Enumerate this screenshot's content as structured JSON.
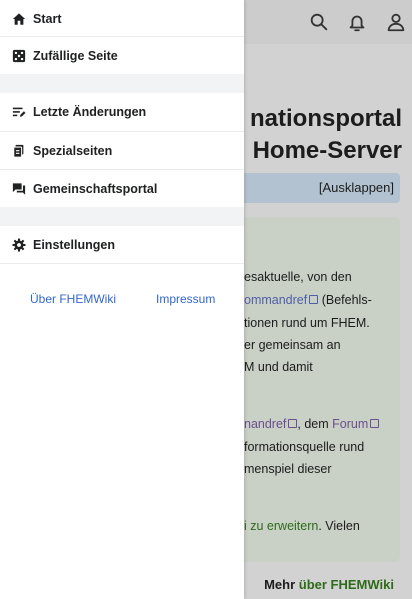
{
  "drawer": {
    "items": [
      {
        "label": "Start",
        "icon": "home-icon"
      },
      {
        "label": "Zufällige Seite",
        "icon": "dice-icon"
      },
      {
        "label": "Letzte Änderungen",
        "icon": "recent-changes-icon"
      },
      {
        "label": "Spezialseiten",
        "icon": "special-pages-icon"
      },
      {
        "label": "Gemeinschaftsportal",
        "icon": "community-portal-icon"
      },
      {
        "label": "Einstellungen",
        "icon": "settings-gear-icon"
      }
    ],
    "footer": {
      "about": "Über FHEMWiki",
      "imprint": "Impressum"
    }
  },
  "header": {
    "icons": [
      "search-icon",
      "bell-icon",
      "user-icon"
    ]
  },
  "background": {
    "title_line1": "nationsportal",
    "title_line2": "Home-Server",
    "expand_label": "[Ausklappen]",
    "lines": {
      "l1": "esaktuelle, von den",
      "l2_link": "ommandref",
      "l2_rest": " (Befehls-",
      "l3": "tionen rund um FHEM.",
      "l4": "er gemeinsam an",
      "l5": "M und damit",
      "l6_link": "nandref",
      "l6_mid": ", dem ",
      "l6_link2": "Forum",
      "l7": "formationsquelle rund",
      "l8": "menspiel dieser",
      "l9_link": "i zu erweitern",
      "l9_rest": ". Vielen"
    },
    "more_prefix": "Mehr ",
    "more_link": "über FHEMWiki"
  },
  "colors": {
    "link": "#3366cc",
    "dim_overlay": "#d2d2d2",
    "drawer_bg": "#ffffff"
  }
}
